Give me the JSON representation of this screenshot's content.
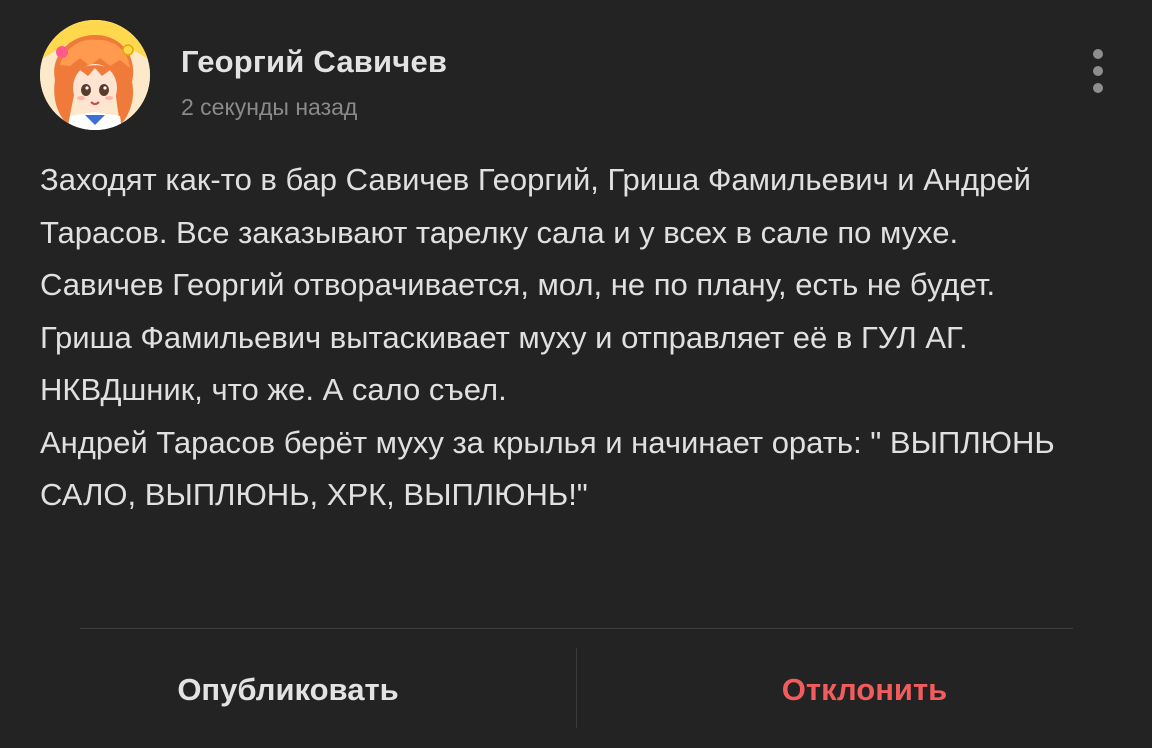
{
  "post": {
    "author_name": "Георгий Савичев",
    "timestamp": "2 секунды назад",
    "avatar_icon": "anime-girl-avatar",
    "more_icon": "vertical-dots-icon",
    "message_lines": [
      "Заходят как-то в бар Савичев Георгий, Гриша Фамильевич и Андрей Тарасов. Все заказывают тарелку сала и у всех в сале по мухе.",
      "Савичев Георгий отворачивается, мол, не по плану, есть не будет.",
      "Гриша Фамильевич вытаскивает муху и отправляет её в ГУЛ АГ. НКВДшник, что же. А сало съел.",
      "Андрей Тарасов берёт муху за крылья и начинает орать: \" ВЫПЛЮНЬ САЛО, ВЫПЛЮНЬ, ХРК, ВЫПЛЮНЬ!\""
    ]
  },
  "actions": {
    "publish_label": "Опубликовать",
    "reject_label": "Отклонить"
  },
  "colors": {
    "background": "#232323",
    "text": "#e0e0e0",
    "muted": "#8a8a8a",
    "reject": "#f25c5c"
  }
}
